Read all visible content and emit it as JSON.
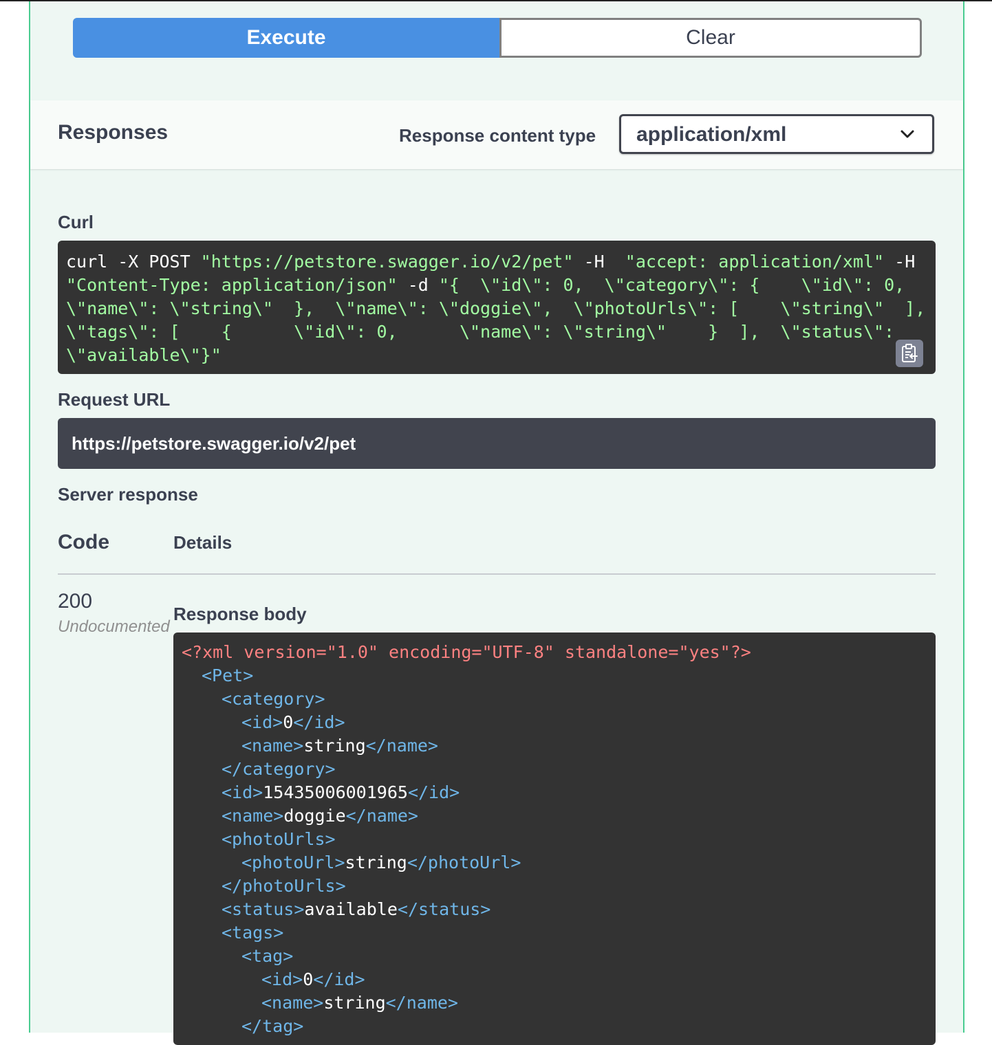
{
  "buttons": {
    "execute": "Execute",
    "clear": "Clear"
  },
  "responses": {
    "title": "Responses",
    "content_type_label": "Response content type",
    "content_type_value": "application/xml"
  },
  "curl": {
    "label": "Curl",
    "lines": [
      [
        {
          "t": "curl -X POST ",
          "c": "w"
        },
        {
          "t": "\"https://petstore.swagger.io/v2/pet\"",
          "c": "g"
        },
        {
          "t": " -H ",
          "c": "w"
        },
        {
          "t": " \"accept: application/xml\"",
          "c": "g"
        },
        {
          "t": " -H",
          "c": "w"
        }
      ],
      [
        {
          "t": "\"Content-Type: application/json\"",
          "c": "g"
        },
        {
          "t": " -d ",
          "c": "w"
        },
        {
          "t": "\"{  \\\"id\\\": 0,  \\\"category\\\": {    \\\"id\\\": 0,",
          "c": "g"
        }
      ],
      [
        {
          "t": "\\\"name\\\": \\\"string\\\"  },  \\\"name\\\": \\\"doggie\\\",  \\\"photoUrls\\\": [    \\\"string\\\"  ],",
          "c": "g"
        }
      ],
      [
        {
          "t": "\\\"tags\\\": [    {      \\\"id\\\": 0,      \\\"name\\\": \\\"string\\\"    }  ],  \\\"status\\\":",
          "c": "g"
        }
      ],
      [
        {
          "t": "\\\"available\\\"}\"",
          "c": "g"
        }
      ]
    ]
  },
  "request_url": {
    "label": "Request URL",
    "value": "https://petstore.swagger.io/v2/pet"
  },
  "server_response": {
    "label": "Server response",
    "col_code": "Code",
    "col_details": "Details",
    "code": "200",
    "code_note": "Undocumented",
    "body_label": "Response body"
  },
  "response_body_lines": [
    {
      "indent": 0,
      "parts": [
        {
          "t": "<?xml version=\"1.0\" encoding=\"UTF-8\" standalone=\"yes\"?>",
          "c": "decl"
        }
      ]
    },
    {
      "indent": 1,
      "parts": [
        {
          "t": "<Pet>",
          "c": "tag"
        }
      ]
    },
    {
      "indent": 2,
      "parts": [
        {
          "t": "<category>",
          "c": "tag"
        }
      ]
    },
    {
      "indent": 3,
      "parts": [
        {
          "t": "<id>",
          "c": "tag"
        },
        {
          "t": "0",
          "c": "txt"
        },
        {
          "t": "</id>",
          "c": "tag"
        }
      ]
    },
    {
      "indent": 3,
      "parts": [
        {
          "t": "<name>",
          "c": "tag"
        },
        {
          "t": "string",
          "c": "txt"
        },
        {
          "t": "</name>",
          "c": "tag"
        }
      ]
    },
    {
      "indent": 2,
      "parts": [
        {
          "t": "</category>",
          "c": "tag"
        }
      ]
    },
    {
      "indent": 2,
      "parts": [
        {
          "t": "<id>",
          "c": "tag"
        },
        {
          "t": "15435006001965",
          "c": "txt"
        },
        {
          "t": "</id>",
          "c": "tag"
        }
      ]
    },
    {
      "indent": 2,
      "parts": [
        {
          "t": "<name>",
          "c": "tag"
        },
        {
          "t": "doggie",
          "c": "txt"
        },
        {
          "t": "</name>",
          "c": "tag"
        }
      ]
    },
    {
      "indent": 2,
      "parts": [
        {
          "t": "<photoUrls>",
          "c": "tag"
        }
      ]
    },
    {
      "indent": 3,
      "parts": [
        {
          "t": "<photoUrl>",
          "c": "tag"
        },
        {
          "t": "string",
          "c": "txt"
        },
        {
          "t": "</photoUrl>",
          "c": "tag"
        }
      ]
    },
    {
      "indent": 2,
      "parts": [
        {
          "t": "</photoUrls>",
          "c": "tag"
        }
      ]
    },
    {
      "indent": 2,
      "parts": [
        {
          "t": "<status>",
          "c": "tag"
        },
        {
          "t": "available",
          "c": "txt"
        },
        {
          "t": "</status>",
          "c": "tag"
        }
      ]
    },
    {
      "indent": 2,
      "parts": [
        {
          "t": "<tags>",
          "c": "tag"
        }
      ]
    },
    {
      "indent": 3,
      "parts": [
        {
          "t": "<tag>",
          "c": "tag"
        }
      ]
    },
    {
      "indent": 4,
      "parts": [
        {
          "t": "<id>",
          "c": "tag"
        },
        {
          "t": "0",
          "c": "txt"
        },
        {
          "t": "</id>",
          "c": "tag"
        }
      ]
    },
    {
      "indent": 4,
      "parts": [
        {
          "t": "<name>",
          "c": "tag"
        },
        {
          "t": "string",
          "c": "txt"
        },
        {
          "t": "</name>",
          "c": "tag"
        }
      ]
    },
    {
      "indent": 3,
      "parts": [
        {
          "t": "</tag>",
          "c": "tag"
        }
      ]
    }
  ],
  "icons": {
    "copy": "clipboard-copy-icon",
    "dropdown": "chevron-down-icon"
  },
  "colors": {
    "execute": "#4990e2",
    "panel_bg": "#eef7f3",
    "panel_border": "#49cc90",
    "code_bg": "#333333",
    "curl_text": "#a2fca2",
    "xml_tag": "#6fb6e8",
    "xml_decl": "#fc8181"
  }
}
